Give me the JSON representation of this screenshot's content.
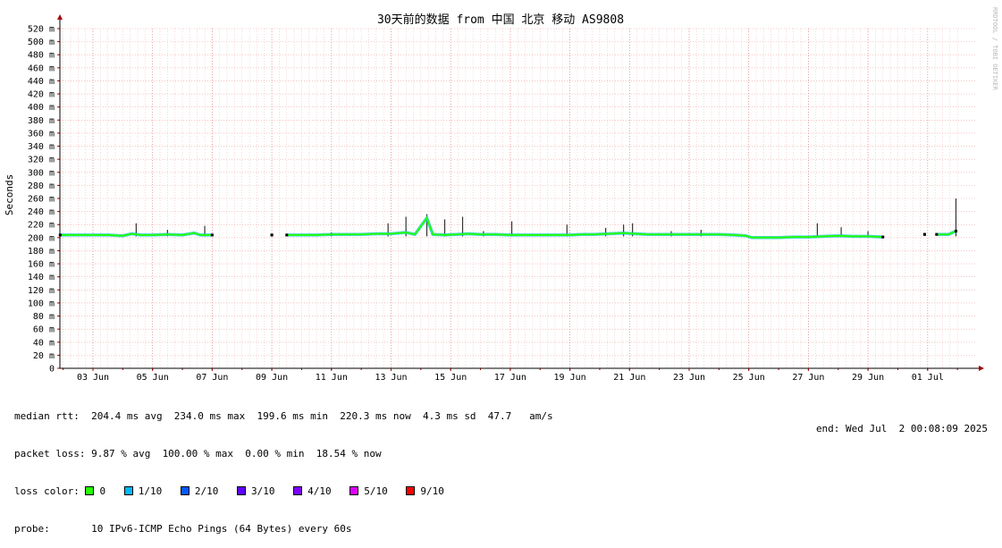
{
  "chart_data": {
    "type": "line",
    "title": "30天前的数据 from 中国 北京 移动 AS9808",
    "ylabel": "Seconds",
    "ylim": [
      0,
      520
    ],
    "yticks": [
      "0",
      "20 m",
      "40 m",
      "60 m",
      "80 m",
      "100 m",
      "120 m",
      "140 m",
      "160 m",
      "180 m",
      "200 m",
      "220 m",
      "240 m",
      "260 m",
      "280 m",
      "300 m",
      "320 m",
      "340 m",
      "360 m",
      "380 m",
      "400 m",
      "420 m",
      "440 m",
      "460 m",
      "480 m",
      "500 m",
      "520 m"
    ],
    "xticks": [
      "03 Jun",
      "05 Jun",
      "07 Jun",
      "09 Jun",
      "11 Jun",
      "13 Jun",
      "15 Jun",
      "17 Jun",
      "19 Jun",
      "21 Jun",
      "23 Jun",
      "25 Jun",
      "27 Jun",
      "29 Jun",
      "01 Jul"
    ],
    "xrange_days": [
      1.9,
      32.0
    ],
    "grid": true,
    "median_rtt_ms": [
      [
        1.9,
        204
      ],
      [
        2.5,
        204
      ],
      [
        3.0,
        204
      ],
      [
        3.5,
        204
      ],
      [
        4.0,
        203
      ],
      [
        4.3,
        206
      ],
      [
        4.6,
        204
      ],
      [
        5.0,
        204
      ],
      [
        5.5,
        205
      ],
      [
        6.0,
        204
      ],
      [
        6.4,
        207
      ],
      [
        6.6,
        204
      ],
      [
        7.0,
        204
      ],
      [
        9.0,
        204
      ],
      [
        9.5,
        204
      ],
      [
        10.0,
        204
      ],
      [
        10.5,
        204
      ],
      [
        11.0,
        205
      ],
      [
        11.5,
        205
      ],
      [
        12.0,
        205
      ],
      [
        12.5,
        206
      ],
      [
        13.0,
        206
      ],
      [
        13.5,
        208
      ],
      [
        13.8,
        205
      ],
      [
        14.2,
        230
      ],
      [
        14.4,
        205
      ],
      [
        14.8,
        204
      ],
      [
        15.2,
        205
      ],
      [
        15.6,
        206
      ],
      [
        16.0,
        205
      ],
      [
        16.5,
        205
      ],
      [
        17.0,
        204
      ],
      [
        17.5,
        204
      ],
      [
        18.0,
        204
      ],
      [
        18.5,
        204
      ],
      [
        19.0,
        204
      ],
      [
        19.4,
        205
      ],
      [
        19.8,
        205
      ],
      [
        20.3,
        206
      ],
      [
        20.8,
        207
      ],
      [
        21.2,
        206
      ],
      [
        21.6,
        205
      ],
      [
        22.0,
        205
      ],
      [
        22.5,
        205
      ],
      [
        23.0,
        205
      ],
      [
        23.5,
        205
      ],
      [
        24.0,
        205
      ],
      [
        24.5,
        204
      ],
      [
        24.9,
        203
      ],
      [
        25.1,
        200
      ],
      [
        25.6,
        200
      ],
      [
        26.0,
        200
      ],
      [
        26.5,
        201
      ],
      [
        27.0,
        201
      ],
      [
        27.5,
        202
      ],
      [
        28.0,
        203
      ],
      [
        28.5,
        202
      ],
      [
        29.0,
        202
      ],
      [
        29.5,
        201
      ],
      [
        30.9,
        205
      ],
      [
        31.3,
        205
      ],
      [
        31.7,
        205
      ],
      [
        31.95,
        210
      ]
    ],
    "loss_segments": [
      {
        "from": 1.9,
        "to": 7.0,
        "loss": "0"
      },
      {
        "from": 9.0,
        "to": 13.8,
        "loss": "0"
      },
      {
        "from": 14.2,
        "to": 19.0,
        "loss": "0"
      },
      {
        "from": 19.4,
        "to": 29.5,
        "loss": "0"
      },
      {
        "from": 30.9,
        "to": 31.95,
        "loss": "0"
      }
    ],
    "rtt_spikes": [
      [
        4.45,
        222
      ],
      [
        5.5,
        212
      ],
      [
        6.75,
        218
      ],
      [
        11.0,
        208
      ],
      [
        12.9,
        222
      ],
      [
        13.5,
        232
      ],
      [
        14.2,
        236
      ],
      [
        14.8,
        228
      ],
      [
        15.4,
        232
      ],
      [
        16.1,
        210
      ],
      [
        17.05,
        225
      ],
      [
        18.9,
        220
      ],
      [
        20.2,
        215
      ],
      [
        20.8,
        220
      ],
      [
        21.1,
        222
      ],
      [
        22.4,
        210
      ],
      [
        23.4,
        212
      ],
      [
        27.3,
        222
      ],
      [
        28.1,
        216
      ],
      [
        29.0,
        210
      ],
      [
        31.95,
        260
      ]
    ],
    "gaps": [
      [
        7.0,
        9.0
      ],
      [
        29.5,
        30.9
      ]
    ]
  },
  "stats": {
    "median_rtt": "median rtt:  204.4 ms avg  234.0 ms max  199.6 ms min  220.3 ms now  4.3 ms sd  47.7   am/s",
    "packet_loss": "packet loss: 9.87 % avg  100.00 % max  0.00 % min  18.54 % now",
    "loss_color_label": "loss color:",
    "loss_colors": [
      {
        "label": "0",
        "color": "#26ff00"
      },
      {
        "label": "1/10",
        "color": "#00b8ff"
      },
      {
        "label": "2/10",
        "color": "#0059ff"
      },
      {
        "label": "3/10",
        "color": "#5e00ff"
      },
      {
        "label": "4/10",
        "color": "#7e00ff"
      },
      {
        "label": "5/10",
        "color": "#dd00ff"
      },
      {
        "label": "9/10",
        "color": "#ff0000"
      }
    ],
    "probe": "probe:       10 IPv6-ICMP Echo Pings (64 Bytes) every 60s",
    "end": "end: Wed Jul  2 00:08:09 2025"
  },
  "watermark": "RRDTOOL / TOBI OETIKER"
}
